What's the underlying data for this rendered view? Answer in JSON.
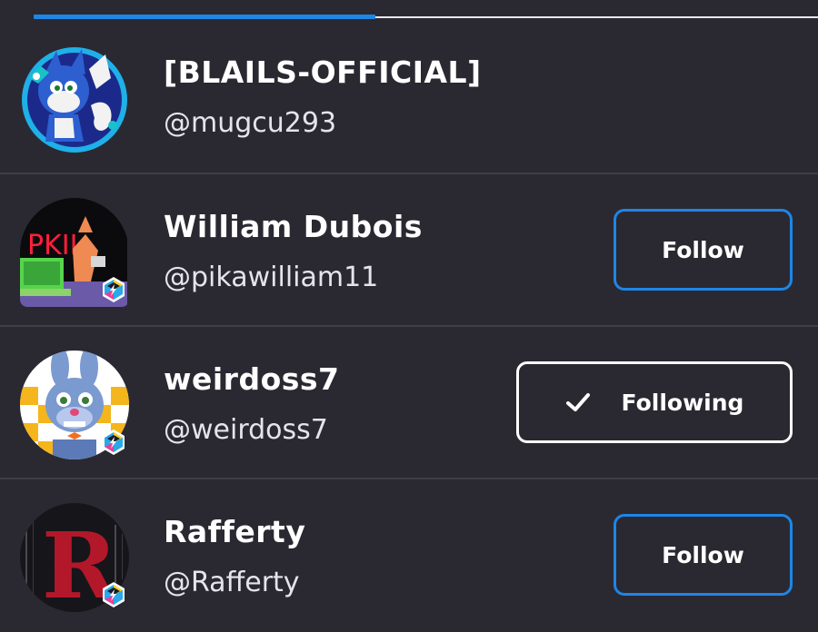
{
  "tabs": {
    "active_color": "#1e86e6"
  },
  "users": [
    {
      "name": "[BLAILS-OFFICIAL]",
      "handle": "@mugcu293",
      "avatar": "tails-fox-avatar-icon",
      "button": null
    },
    {
      "name": "William Dubois",
      "handle": "@pikawilliam11",
      "avatar": "pk-computer-avatar-icon",
      "button": {
        "label": "Follow",
        "state": "follow"
      }
    },
    {
      "name": "weirdoss7",
      "handle": "@weirdoss7",
      "avatar": "bonnie-animatronic-avatar-icon",
      "button": {
        "label": "Following",
        "state": "following"
      }
    },
    {
      "name": "Rafferty",
      "handle": "@Rafferty",
      "avatar": "letter-r-avatar-icon",
      "button": {
        "label": "Follow",
        "state": "follow"
      }
    }
  ],
  "colors": {
    "background": "#2a2931",
    "follow_border": "#1e86e6",
    "following_border": "#ffffff"
  }
}
